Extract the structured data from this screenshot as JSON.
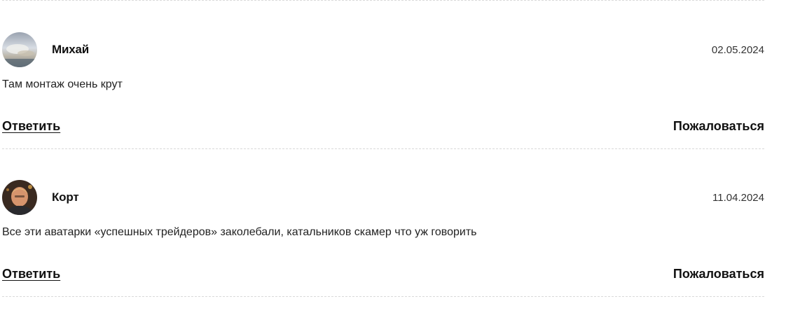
{
  "comments": [
    {
      "author": "Михай",
      "date": "02.05.2024",
      "text": "Там монтаж очень крут",
      "reply_label": "Ответить",
      "report_label": "Пожаловаться"
    },
    {
      "author": "Корт",
      "date": "11.04.2024",
      "text": "Все эти аватарки «успешных трейдеров» заколебали, катальников скамер что уж говорить",
      "reply_label": "Ответить",
      "report_label": "Пожаловаться"
    }
  ]
}
